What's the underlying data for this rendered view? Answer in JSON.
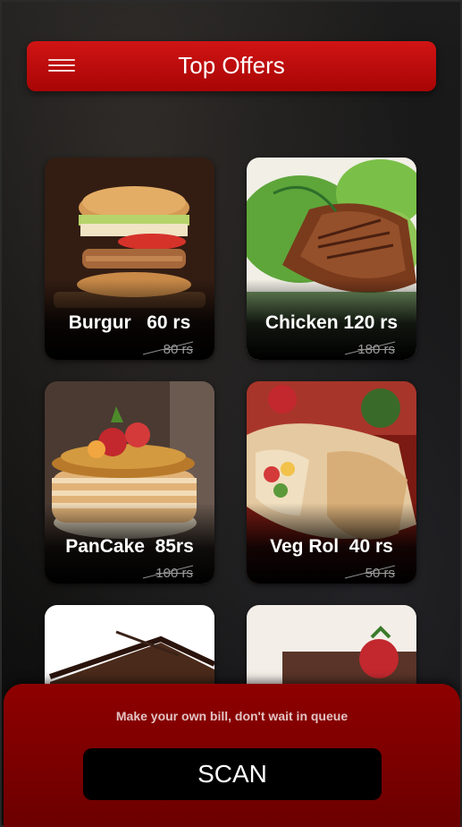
{
  "header": {
    "title": "Top Offers",
    "menu_icon": "hamburger-menu-icon"
  },
  "offers": [
    {
      "name": "Burgur   60 rs",
      "old_price": "80 rs",
      "image": "burger"
    },
    {
      "name": "Chicken 120 rs",
      "old_price": "180 rs",
      "image": "grilled-chicken"
    },
    {
      "name": "PanCake  85rs",
      "old_price": "100 rs",
      "image": "pancake"
    },
    {
      "name": "Veg Rol  40 rs",
      "old_price": "50 rs",
      "image": "veg-roll"
    },
    {
      "name": "",
      "old_price": "",
      "image": "chocolate-cake"
    },
    {
      "name": "",
      "old_price": "",
      "image": "cake-with-strawberry"
    }
  ],
  "bottom": {
    "bill_text": "Make your own bill, don't wait in queue",
    "scan_label": "SCAN"
  },
  "colors": {
    "accent": "#c40c0c",
    "panel": "#7a0000",
    "button": "#000000"
  }
}
